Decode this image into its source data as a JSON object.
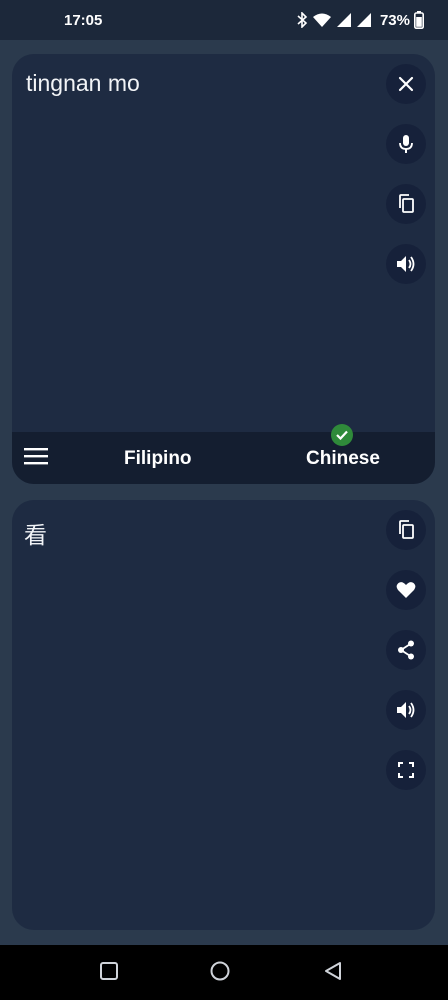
{
  "status_bar": {
    "time": "17:05",
    "battery": "73%",
    "icons": [
      "bluetooth-icon",
      "wifi-icon",
      "signal-icon",
      "signal-icon",
      "battery-icon"
    ]
  },
  "input_card": {
    "text": "tingnan mo",
    "buttons": [
      "close-icon",
      "mic-icon",
      "copy-icon",
      "volume-icon"
    ]
  },
  "language_bar": {
    "menu_icon": "hamburger-menu-icon",
    "source_language": "Filipino",
    "target_language": "Chinese",
    "selected_indicator": "check-icon"
  },
  "output_card": {
    "text": "看",
    "buttons": [
      "copy-icon",
      "heart-icon",
      "share-icon",
      "volume-icon",
      "fullscreen-icon"
    ]
  },
  "nav_bar": {
    "buttons": [
      "recents-square-icon",
      "home-circle-icon",
      "back-triangle-icon"
    ]
  },
  "colors": {
    "background": "#2b3a4d",
    "card": "#1e2b42",
    "language_bar": "#141e30",
    "button": "#16213a",
    "check": "#2f8a3a"
  }
}
